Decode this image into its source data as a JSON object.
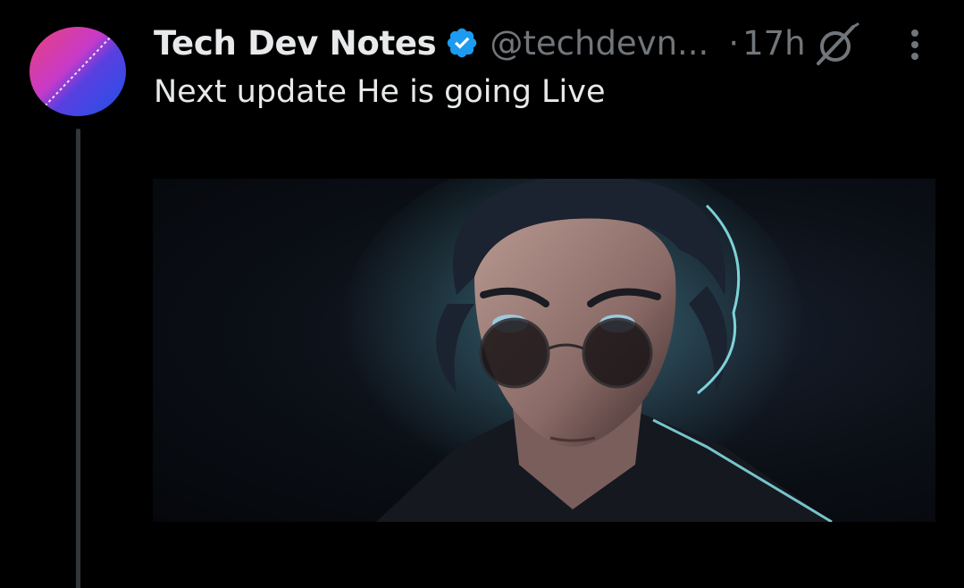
{
  "tweet": {
    "author": {
      "display_name": "Tech Dev Notes",
      "handle": "@techdevn...",
      "verified": true,
      "avatar_colors": [
        "#e8417a",
        "#c83ac8",
        "#5a3fe0",
        "#1f52e8"
      ]
    },
    "separator": "·",
    "timestamp": "17h",
    "text": "Next update He is going Live",
    "icons": {
      "verified": "verified-badge-icon",
      "grok": "grok-icon",
      "more": "more-vertical-icon"
    },
    "media": {
      "type": "image",
      "subject": "animated character with dark hair and round sunglasses"
    }
  },
  "colors": {
    "background": "#000000",
    "primary_text": "#e7e9ea",
    "secondary_text": "#71767b",
    "verified_blue": "#1d9bf0",
    "thread_line": "#333639"
  }
}
